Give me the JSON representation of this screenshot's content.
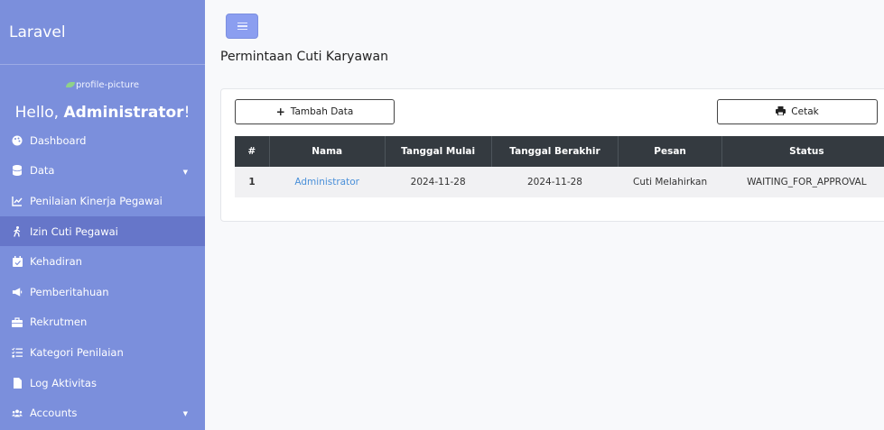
{
  "sidebar": {
    "brand": "Laravel",
    "profile_alt": "profile-picture",
    "greeting": "Hello,",
    "user_name": "Administrator",
    "greeting_end": "!",
    "items": [
      {
        "label": "Dashboard",
        "icon": "palette-icon"
      },
      {
        "label": "Data",
        "icon": "database-icon"
      },
      {
        "label": "Penilaian Kinerja Pegawai",
        "icon": "chart-line-icon"
      },
      {
        "label": "Izin Cuti Pegawai",
        "icon": "walking-person-icon"
      },
      {
        "label": "Kehadiran",
        "icon": "calendar-check-icon"
      },
      {
        "label": "Pemberitahuan",
        "icon": "megaphone-icon"
      },
      {
        "label": "Rekrutmen",
        "icon": "briefcase-icon"
      },
      {
        "label": "Kategori Penilaian",
        "icon": "list-check-icon"
      },
      {
        "label": "Log Aktivitas",
        "icon": "file-icon"
      },
      {
        "label": "Accounts",
        "icon": "users-icon"
      }
    ]
  },
  "header": {
    "page_title": "Permintaan Cuti Karyawan"
  },
  "toolbar": {
    "add_label": "Tambah Data",
    "print_label": "Cetak"
  },
  "table": {
    "headers": [
      "#",
      "Nama",
      "Tanggal Mulai",
      "Tanggal Berakhir",
      "Pesan",
      "Status"
    ],
    "rows": [
      [
        "1",
        "Administrator",
        "2024-11-28",
        "2024-11-28",
        "Cuti Melahirkan",
        "WAITING_FOR_APPROVAL"
      ]
    ]
  },
  "colors": {
    "sidebar": "#7b8fdc",
    "sidebar_active": "#6676c9",
    "table_header": "#343a40",
    "link": "#4a90d9"
  }
}
